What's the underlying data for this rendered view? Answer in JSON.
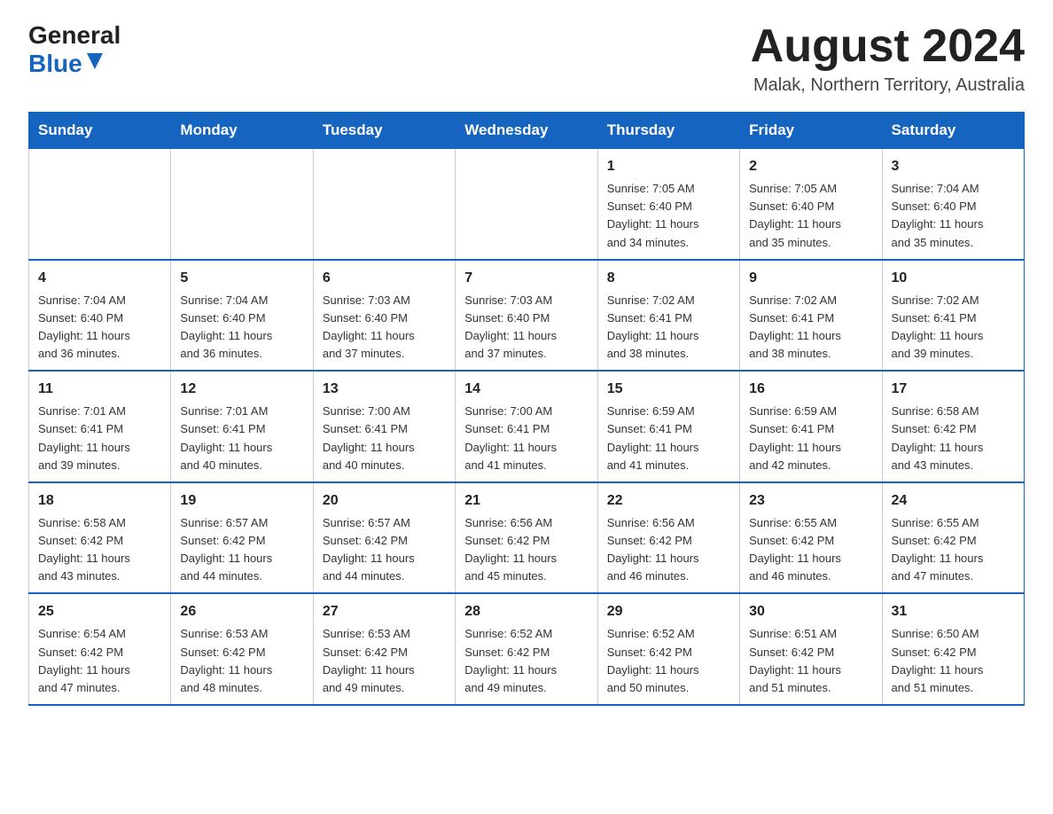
{
  "header": {
    "logo_general": "General",
    "logo_blue": "Blue",
    "month_title": "August 2024",
    "location": "Malak, Northern Territory, Australia"
  },
  "days_of_week": [
    "Sunday",
    "Monday",
    "Tuesday",
    "Wednesday",
    "Thursday",
    "Friday",
    "Saturday"
  ],
  "weeks": [
    [
      {
        "day": "",
        "info": ""
      },
      {
        "day": "",
        "info": ""
      },
      {
        "day": "",
        "info": ""
      },
      {
        "day": "",
        "info": ""
      },
      {
        "day": "1",
        "info": "Sunrise: 7:05 AM\nSunset: 6:40 PM\nDaylight: 11 hours\nand 34 minutes."
      },
      {
        "day": "2",
        "info": "Sunrise: 7:05 AM\nSunset: 6:40 PM\nDaylight: 11 hours\nand 35 minutes."
      },
      {
        "day": "3",
        "info": "Sunrise: 7:04 AM\nSunset: 6:40 PM\nDaylight: 11 hours\nand 35 minutes."
      }
    ],
    [
      {
        "day": "4",
        "info": "Sunrise: 7:04 AM\nSunset: 6:40 PM\nDaylight: 11 hours\nand 36 minutes."
      },
      {
        "day": "5",
        "info": "Sunrise: 7:04 AM\nSunset: 6:40 PM\nDaylight: 11 hours\nand 36 minutes."
      },
      {
        "day": "6",
        "info": "Sunrise: 7:03 AM\nSunset: 6:40 PM\nDaylight: 11 hours\nand 37 minutes."
      },
      {
        "day": "7",
        "info": "Sunrise: 7:03 AM\nSunset: 6:40 PM\nDaylight: 11 hours\nand 37 minutes."
      },
      {
        "day": "8",
        "info": "Sunrise: 7:02 AM\nSunset: 6:41 PM\nDaylight: 11 hours\nand 38 minutes."
      },
      {
        "day": "9",
        "info": "Sunrise: 7:02 AM\nSunset: 6:41 PM\nDaylight: 11 hours\nand 38 minutes."
      },
      {
        "day": "10",
        "info": "Sunrise: 7:02 AM\nSunset: 6:41 PM\nDaylight: 11 hours\nand 39 minutes."
      }
    ],
    [
      {
        "day": "11",
        "info": "Sunrise: 7:01 AM\nSunset: 6:41 PM\nDaylight: 11 hours\nand 39 minutes."
      },
      {
        "day": "12",
        "info": "Sunrise: 7:01 AM\nSunset: 6:41 PM\nDaylight: 11 hours\nand 40 minutes."
      },
      {
        "day": "13",
        "info": "Sunrise: 7:00 AM\nSunset: 6:41 PM\nDaylight: 11 hours\nand 40 minutes."
      },
      {
        "day": "14",
        "info": "Sunrise: 7:00 AM\nSunset: 6:41 PM\nDaylight: 11 hours\nand 41 minutes."
      },
      {
        "day": "15",
        "info": "Sunrise: 6:59 AM\nSunset: 6:41 PM\nDaylight: 11 hours\nand 41 minutes."
      },
      {
        "day": "16",
        "info": "Sunrise: 6:59 AM\nSunset: 6:41 PM\nDaylight: 11 hours\nand 42 minutes."
      },
      {
        "day": "17",
        "info": "Sunrise: 6:58 AM\nSunset: 6:42 PM\nDaylight: 11 hours\nand 43 minutes."
      }
    ],
    [
      {
        "day": "18",
        "info": "Sunrise: 6:58 AM\nSunset: 6:42 PM\nDaylight: 11 hours\nand 43 minutes."
      },
      {
        "day": "19",
        "info": "Sunrise: 6:57 AM\nSunset: 6:42 PM\nDaylight: 11 hours\nand 44 minutes."
      },
      {
        "day": "20",
        "info": "Sunrise: 6:57 AM\nSunset: 6:42 PM\nDaylight: 11 hours\nand 44 minutes."
      },
      {
        "day": "21",
        "info": "Sunrise: 6:56 AM\nSunset: 6:42 PM\nDaylight: 11 hours\nand 45 minutes."
      },
      {
        "day": "22",
        "info": "Sunrise: 6:56 AM\nSunset: 6:42 PM\nDaylight: 11 hours\nand 46 minutes."
      },
      {
        "day": "23",
        "info": "Sunrise: 6:55 AM\nSunset: 6:42 PM\nDaylight: 11 hours\nand 46 minutes."
      },
      {
        "day": "24",
        "info": "Sunrise: 6:55 AM\nSunset: 6:42 PM\nDaylight: 11 hours\nand 47 minutes."
      }
    ],
    [
      {
        "day": "25",
        "info": "Sunrise: 6:54 AM\nSunset: 6:42 PM\nDaylight: 11 hours\nand 47 minutes."
      },
      {
        "day": "26",
        "info": "Sunrise: 6:53 AM\nSunset: 6:42 PM\nDaylight: 11 hours\nand 48 minutes."
      },
      {
        "day": "27",
        "info": "Sunrise: 6:53 AM\nSunset: 6:42 PM\nDaylight: 11 hours\nand 49 minutes."
      },
      {
        "day": "28",
        "info": "Sunrise: 6:52 AM\nSunset: 6:42 PM\nDaylight: 11 hours\nand 49 minutes."
      },
      {
        "day": "29",
        "info": "Sunrise: 6:52 AM\nSunset: 6:42 PM\nDaylight: 11 hours\nand 50 minutes."
      },
      {
        "day": "30",
        "info": "Sunrise: 6:51 AM\nSunset: 6:42 PM\nDaylight: 11 hours\nand 51 minutes."
      },
      {
        "day": "31",
        "info": "Sunrise: 6:50 AM\nSunset: 6:42 PM\nDaylight: 11 hours\nand 51 minutes."
      }
    ]
  ]
}
